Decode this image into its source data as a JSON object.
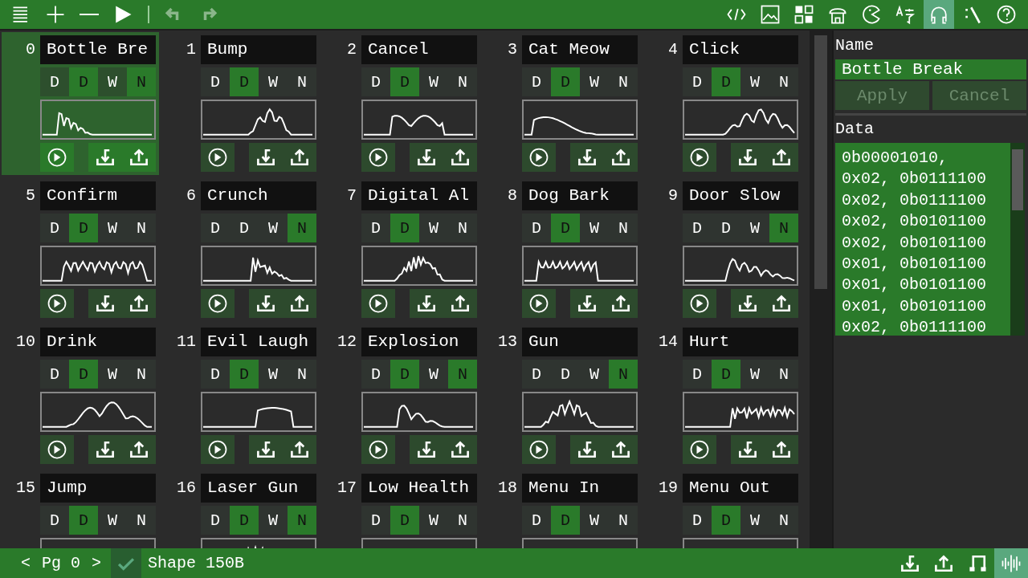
{
  "toolbar": {
    "left": [
      {
        "kind": "menu"
      },
      {
        "kind": "plus"
      },
      {
        "kind": "minus"
      },
      {
        "kind": "play"
      },
      {
        "kind": "divider"
      },
      {
        "kind": "undo",
        "disabled": true
      },
      {
        "kind": "redo",
        "disabled": true
      }
    ],
    "tabs": [
      {
        "kind": "code",
        "selected": false
      },
      {
        "kind": "image",
        "selected": false
      },
      {
        "kind": "tiles",
        "selected": false
      },
      {
        "kind": "store",
        "selected": false
      },
      {
        "kind": "pacman",
        "selected": false
      },
      {
        "kind": "translate",
        "selected": false
      },
      {
        "kind": "headphones",
        "selected": true
      },
      {
        "kind": "terminal",
        "selected": false
      },
      {
        "kind": "help",
        "selected": false
      }
    ]
  },
  "sounds": [
    {
      "number": "0",
      "name": "Bottle Bre",
      "selected": true,
      "toggles": [
        {
          "label": "D",
          "on": false
        },
        {
          "label": "D",
          "on": true
        },
        {
          "label": "W",
          "on": false
        },
        {
          "label": "N",
          "on": true
        }
      ]
    },
    {
      "number": "1",
      "name": "Bump",
      "selected": false,
      "toggles": [
        {
          "label": "D",
          "on": false
        },
        {
          "label": "D",
          "on": true
        },
        {
          "label": "W",
          "on": false
        },
        {
          "label": "N",
          "on": false
        }
      ]
    },
    {
      "number": "2",
      "name": "Cancel",
      "selected": false,
      "toggles": [
        {
          "label": "D",
          "on": false
        },
        {
          "label": "D",
          "on": true
        },
        {
          "label": "W",
          "on": false
        },
        {
          "label": "N",
          "on": false
        }
      ]
    },
    {
      "number": "3",
      "name": "Cat Meow",
      "selected": false,
      "toggles": [
        {
          "label": "D",
          "on": false
        },
        {
          "label": "D",
          "on": true
        },
        {
          "label": "W",
          "on": false
        },
        {
          "label": "N",
          "on": false
        }
      ]
    },
    {
      "number": "4",
      "name": "Click",
      "selected": false,
      "toggles": [
        {
          "label": "D",
          "on": false
        },
        {
          "label": "D",
          "on": true
        },
        {
          "label": "W",
          "on": false
        },
        {
          "label": "N",
          "on": false
        }
      ]
    },
    {
      "number": "5",
      "name": "Confirm",
      "selected": false,
      "toggles": [
        {
          "label": "D",
          "on": false
        },
        {
          "label": "D",
          "on": true
        },
        {
          "label": "W",
          "on": false
        },
        {
          "label": "N",
          "on": false
        }
      ]
    },
    {
      "number": "6",
      "name": "Crunch",
      "selected": false,
      "toggles": [
        {
          "label": "D",
          "on": false
        },
        {
          "label": "D",
          "on": false
        },
        {
          "label": "W",
          "on": false
        },
        {
          "label": "N",
          "on": true
        }
      ]
    },
    {
      "number": "7",
      "name": "Digital Al",
      "selected": false,
      "toggles": [
        {
          "label": "D",
          "on": false
        },
        {
          "label": "D",
          "on": true
        },
        {
          "label": "W",
          "on": false
        },
        {
          "label": "N",
          "on": false
        }
      ]
    },
    {
      "number": "8",
      "name": "Dog Bark",
      "selected": false,
      "toggles": [
        {
          "label": "D",
          "on": false
        },
        {
          "label": "D",
          "on": true
        },
        {
          "label": "W",
          "on": false
        },
        {
          "label": "N",
          "on": false
        }
      ]
    },
    {
      "number": "9",
      "name": "Door Slow",
      "selected": false,
      "toggles": [
        {
          "label": "D",
          "on": false
        },
        {
          "label": "D",
          "on": false
        },
        {
          "label": "W",
          "on": false
        },
        {
          "label": "N",
          "on": true
        }
      ]
    },
    {
      "number": "10",
      "name": "Drink",
      "selected": false,
      "toggles": [
        {
          "label": "D",
          "on": false
        },
        {
          "label": "D",
          "on": true
        },
        {
          "label": "W",
          "on": false
        },
        {
          "label": "N",
          "on": false
        }
      ]
    },
    {
      "number": "11",
      "name": "Evil Laugh",
      "selected": false,
      "toggles": [
        {
          "label": "D",
          "on": false
        },
        {
          "label": "D",
          "on": true
        },
        {
          "label": "W",
          "on": false
        },
        {
          "label": "N",
          "on": false
        }
      ]
    },
    {
      "number": "12",
      "name": "Explosion",
      "selected": false,
      "toggles": [
        {
          "label": "D",
          "on": false
        },
        {
          "label": "D",
          "on": true
        },
        {
          "label": "W",
          "on": false
        },
        {
          "label": "N",
          "on": true
        }
      ]
    },
    {
      "number": "13",
      "name": "Gun",
      "selected": false,
      "toggles": [
        {
          "label": "D",
          "on": false
        },
        {
          "label": "D",
          "on": false
        },
        {
          "label": "W",
          "on": false
        },
        {
          "label": "N",
          "on": true
        }
      ]
    },
    {
      "number": "14",
      "name": "Hurt",
      "selected": false,
      "toggles": [
        {
          "label": "D",
          "on": false
        },
        {
          "label": "D",
          "on": true
        },
        {
          "label": "W",
          "on": false
        },
        {
          "label": "N",
          "on": false
        }
      ]
    },
    {
      "number": "15",
      "name": "Jump",
      "selected": false,
      "toggles": [
        {
          "label": "D",
          "on": false
        },
        {
          "label": "D",
          "on": true
        },
        {
          "label": "W",
          "on": false
        },
        {
          "label": "N",
          "on": false
        }
      ]
    },
    {
      "number": "16",
      "name": "Laser Gun",
      "selected": false,
      "toggles": [
        {
          "label": "D",
          "on": false
        },
        {
          "label": "D",
          "on": true
        },
        {
          "label": "W",
          "on": false
        },
        {
          "label": "N",
          "on": true
        }
      ]
    },
    {
      "number": "17",
      "name": "Low Health",
      "selected": false,
      "toggles": [
        {
          "label": "D",
          "on": false
        },
        {
          "label": "D",
          "on": true
        },
        {
          "label": "W",
          "on": false
        },
        {
          "label": "N",
          "on": false
        }
      ]
    },
    {
      "number": "18",
      "name": "Menu In",
      "selected": false,
      "toggles": [
        {
          "label": "D",
          "on": false
        },
        {
          "label": "D",
          "on": true
        },
        {
          "label": "W",
          "on": false
        },
        {
          "label": "N",
          "on": false
        }
      ]
    },
    {
      "number": "19",
      "name": "Menu Out",
      "selected": false,
      "toggles": [
        {
          "label": "D",
          "on": false
        },
        {
          "label": "D",
          "on": true
        },
        {
          "label": "W",
          "on": false
        },
        {
          "label": "N",
          "on": false
        }
      ]
    }
  ],
  "editor": {
    "name_label": "Name",
    "name_value": "Bottle Break",
    "buttons": [
      {
        "label": "Apply",
        "disabled": true
      },
      {
        "label": "Cancel",
        "disabled": true
      }
    ],
    "data_label": "Data",
    "data_lines": [
      "0b00001010,",
      "0x02, 0b0111100",
      "0x02, 0b0111100",
      "0x02, 0b0101100",
      "0x02, 0b0101100",
      "0x01, 0b0101100",
      "0x01, 0b0101100",
      "0x01, 0b0101100",
      "0x02, 0b0111100"
    ]
  },
  "status_bar": {
    "prev": "<",
    "page": "Pg 0",
    "next": ">",
    "status": "Shape 150B",
    "tools": [
      {
        "kind": "import",
        "selected": false
      },
      {
        "kind": "export",
        "selected": false
      },
      {
        "kind": "music",
        "selected": false
      },
      {
        "kind": "wave",
        "selected": true
      }
    ]
  }
}
